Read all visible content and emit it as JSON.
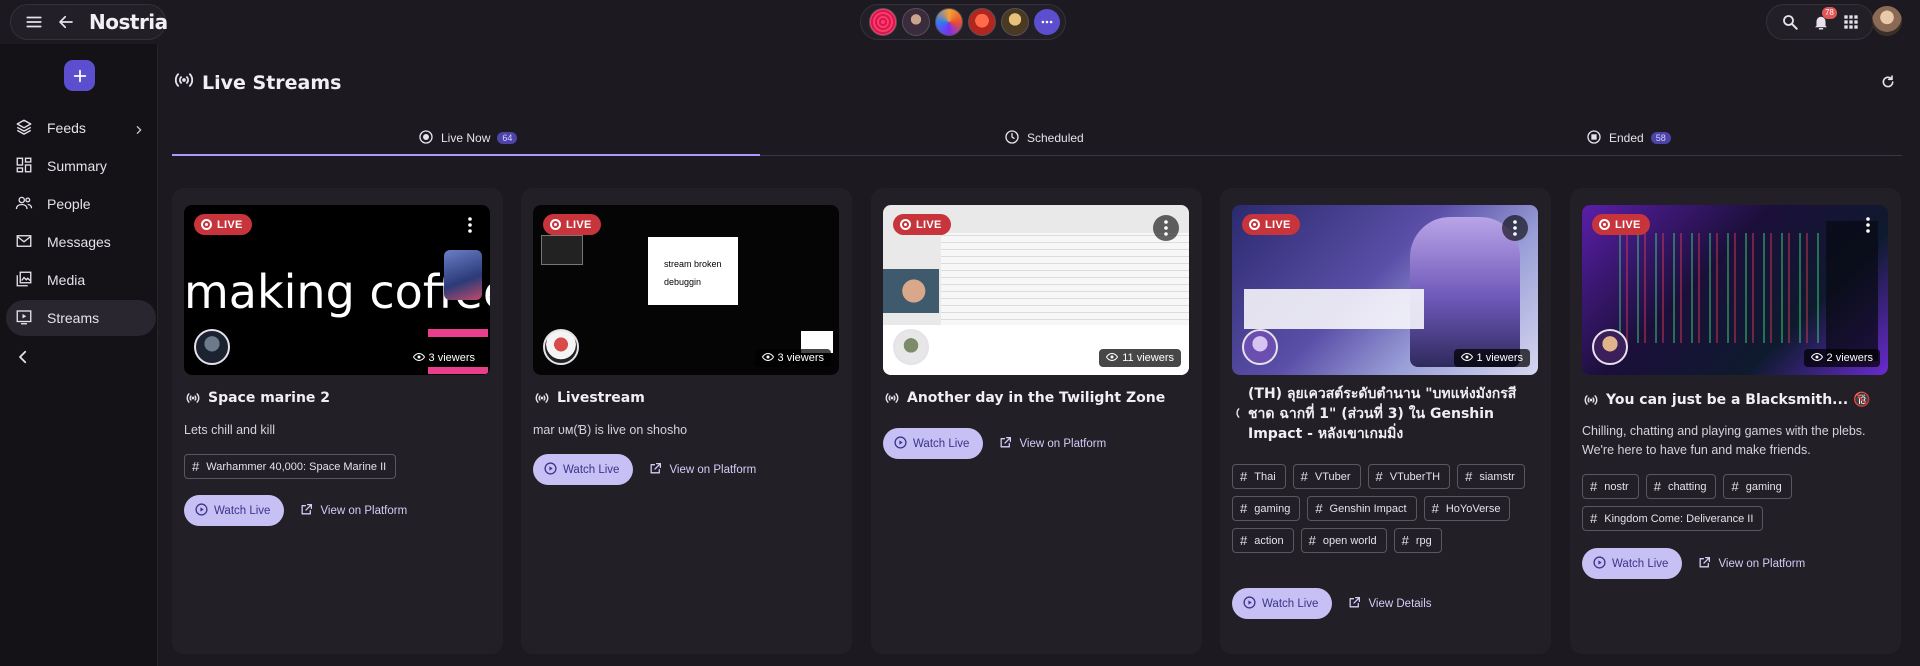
{
  "app": {
    "name": "Nostria"
  },
  "notifications": {
    "count": "78"
  },
  "sidebar": {
    "items": [
      {
        "label": "Feeds",
        "icon": "layers-icon"
      },
      {
        "label": "Summary",
        "icon": "dashboard-icon"
      },
      {
        "label": "People",
        "icon": "people-icon"
      },
      {
        "label": "Messages",
        "icon": "mail-icon"
      },
      {
        "label": "Media",
        "icon": "image-library-icon"
      },
      {
        "label": "Streams",
        "icon": "live-tv-icon"
      }
    ]
  },
  "page": {
    "title": "Live Streams"
  },
  "tabs": [
    {
      "label": "Live Now",
      "count": "64"
    },
    {
      "label": "Scheduled",
      "count": ""
    },
    {
      "label": "Ended",
      "count": "58"
    }
  ],
  "streams": [
    {
      "live": "LIVE",
      "thumb_text": "making coffee",
      "viewers": "3 viewers",
      "title": "Space marine 2",
      "description": "Lets chill and kill",
      "tags": [
        "Warhammer 40,000: Space Marine II"
      ],
      "watch_label": "Watch Live",
      "secondary_label": "View on Platform"
    },
    {
      "live": "LIVE",
      "thumb_line1": "stream broken",
      "thumb_line2": "debuggin",
      "viewers": "3 viewers",
      "title": "Livestream",
      "description": "mar ᴜᴍ(Ɓ) is live on shosho",
      "tags": [],
      "watch_label": "Watch Live",
      "secondary_label": "View on Platform"
    },
    {
      "live": "LIVE",
      "viewers": "11 viewers",
      "title": "Another day in the Twilight Zone",
      "description": "",
      "tags": [],
      "watch_label": "Watch Live",
      "secondary_label": "View on Platform"
    },
    {
      "live": "LIVE",
      "viewers": "1 viewers",
      "title": "(TH) ลุยเควสต์ระดับตำนาน \"บทแห่งมังกรสีชาด ฉากที่ 1\" (ส่วนที่ 3) ใน Genshin Impact - หลังเขาเกมมิ่ง",
      "description": "",
      "tags": [
        "Thai",
        "VTuber",
        "VTuberTH",
        "siamstr",
        "gaming",
        "Genshin Impact",
        "HoYoVerse",
        "action",
        "open world",
        "rpg"
      ],
      "watch_label": "Watch Live",
      "secondary_label": "View Details"
    },
    {
      "live": "LIVE",
      "viewers": "2 viewers",
      "title": "You can just be a Blacksmith... 🔞",
      "description": "Chilling, chatting and playing games with the plebs. We're here to have fun and make friends.",
      "tags": [
        "nostr",
        "chatting",
        "gaming",
        "Kingdom Come: Deliverance II"
      ],
      "watch_label": "Watch Live",
      "secondary_label": "View on Platform"
    }
  ],
  "colors": {
    "accent": "#a99cff",
    "live": "#c8343b",
    "button": "#c7c0f5"
  }
}
